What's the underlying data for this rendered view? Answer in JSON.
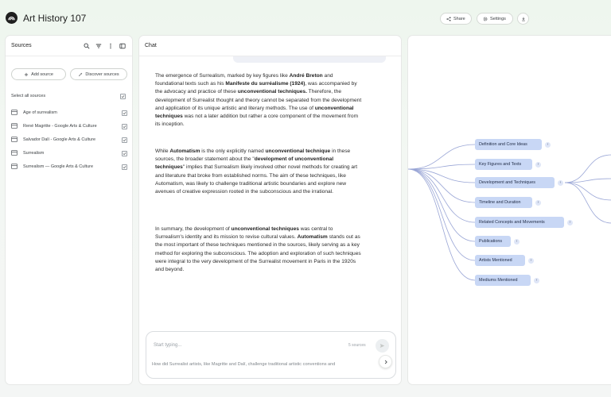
{
  "app": {
    "title": "Art History 107",
    "share_label": "Share",
    "settings_label": "Settings"
  },
  "sources": {
    "title": "Sources",
    "add_label": "Add source",
    "discover_label": "Discover sources",
    "select_all_label": "Select all sources",
    "items": [
      {
        "label": "Age of surrealism"
      },
      {
        "label": "René Magritte - Google Arts & Culture"
      },
      {
        "label": "Salvador Dalí - Google Arts & Culture"
      },
      {
        "label": "Surrealism"
      },
      {
        "label": "Surrealism — Google Arts & Culture"
      }
    ]
  },
  "chat": {
    "title": "Chat",
    "paragraphs": [
      [
        {
          "t": "The emergence of Surrealism, marked by key figures like "
        },
        {
          "t": "André Breton",
          "b": true
        },
        {
          "t": " and foundational texts such as his "
        },
        {
          "t": "Manifeste du surréalisme (1924)",
          "b": true
        },
        {
          "t": ", was accompanied by the advocacy and practice of these "
        },
        {
          "t": "unconventional techniques.",
          "b": true
        },
        {
          "t": " Therefore, the development of Surrealist thought and theory cannot be separated from the development and application of its unique artistic and literary methods. The use of "
        },
        {
          "t": "unconventional techniques",
          "b": true
        },
        {
          "t": " was not a later addition but rather a core component of the movement from its inception."
        }
      ],
      [
        {
          "t": "While "
        },
        {
          "t": "Automatism",
          "b": true
        },
        {
          "t": " is the only explicitly named "
        },
        {
          "t": "unconventional technique",
          "b": true
        },
        {
          "t": " in these sources, the broader statement about the \""
        },
        {
          "t": "development of unconventional techniques",
          "b": true
        },
        {
          "t": "\" implies that Surrealism likely involved other novel methods for creating art and literature that broke from established norms. The aim of these techniques, like Automatism, was likely to challenge traditional artistic boundaries and explore new avenues of creative expression rooted in the subconscious and the irrational."
        }
      ],
      [
        {
          "t": "In summary, the development of "
        },
        {
          "t": "unconventional techniques",
          "b": true
        },
        {
          "t": " was central to Surrealism's identity and its mission to revise cultural values. "
        },
        {
          "t": "Automatism",
          "b": true
        },
        {
          "t": " stands out as the most important of these techniques mentioned in the sources, likely serving as a key method for exploring the subconscious. The adoption and exploration of such techniques were integral to the very development of the Surrealist movement in Paris in the 1920s and beyond."
        }
      ]
    ],
    "input_placeholder": "Start typing...",
    "source_count": "5 sources",
    "suggestion": "How did Surrealist artists, like Magritte and Dalí, challenge traditional artistic conventions and"
  },
  "mindmap": {
    "nodes": [
      {
        "label": "Definition and Core Ideas",
        "toggle": "›"
      },
      {
        "label": "Key Figures and Texts",
        "toggle": "›"
      },
      {
        "label": "Development and Techniques",
        "toggle": "‹"
      },
      {
        "label": "Timeline and Duration",
        "toggle": "›"
      },
      {
        "label": "Related Concepts and Movements",
        "toggle": "›"
      },
      {
        "label": "Publications",
        "toggle": "›"
      },
      {
        "label": "Artists Mentioned",
        "toggle": "›"
      },
      {
        "label": "Mediums Mentioned",
        "toggle": "›"
      }
    ]
  }
}
